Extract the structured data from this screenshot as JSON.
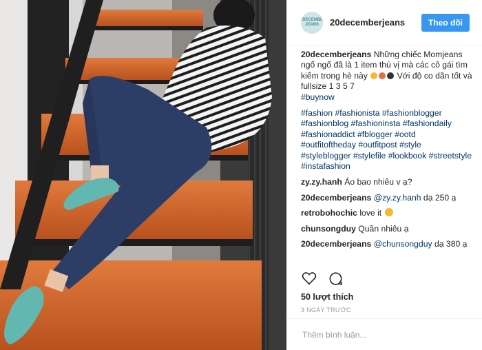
{
  "post": {
    "username": "20decemberjeans",
    "avatar_text": "20DECEMBER JEANS",
    "follow_label": "Theo dõi",
    "caption": {
      "user": "20decemberjeans",
      "text_1": "Những chiếc Momjeans ngố ngố đã là 1 item thú vị mà các cô gái tìm kiếm trong hè này",
      "text_2": "Với độ co dãn tốt và fullsize 1 3 5 7",
      "hashtag_first": "#buynow",
      "hashtags": [
        "#fashion",
        "#fashionista",
        "#fashionblogger",
        "#fashionblog",
        "#fashioninsta",
        "#fashiondaily",
        "#fashionaddict",
        "#fblogger",
        "#ootd",
        "#outfitoftheday",
        "#outfitpost",
        "#style",
        "#styleblogger",
        "#stylefile",
        "#lookbook",
        "#streetstyle",
        "#instafashion"
      ]
    },
    "comments": [
      {
        "user": "zy.zy.hanh",
        "mention": "",
        "text": "Áo bao nhiêu v ạ?"
      },
      {
        "user": "20decemberjeans",
        "mention": "@zy.zy.hanh",
        "text": "dạ 250 ạ"
      },
      {
        "user": "retrobohochic",
        "mention": "",
        "text": "love it"
      },
      {
        "user": "chunsongduy",
        "mention": "",
        "text": "Quần nhiêu ạ"
      },
      {
        "user": "20decemberjeans",
        "mention": "@chunsongduy",
        "text": "dạ 380 ạ"
      }
    ],
    "likes": "50 lượt thích",
    "time": "3 NGÀY TRƯỚC",
    "comment_placeholder": "Thêm bình luận..."
  },
  "icons": {
    "like": "heart-icon",
    "comment": "comment-icon"
  }
}
